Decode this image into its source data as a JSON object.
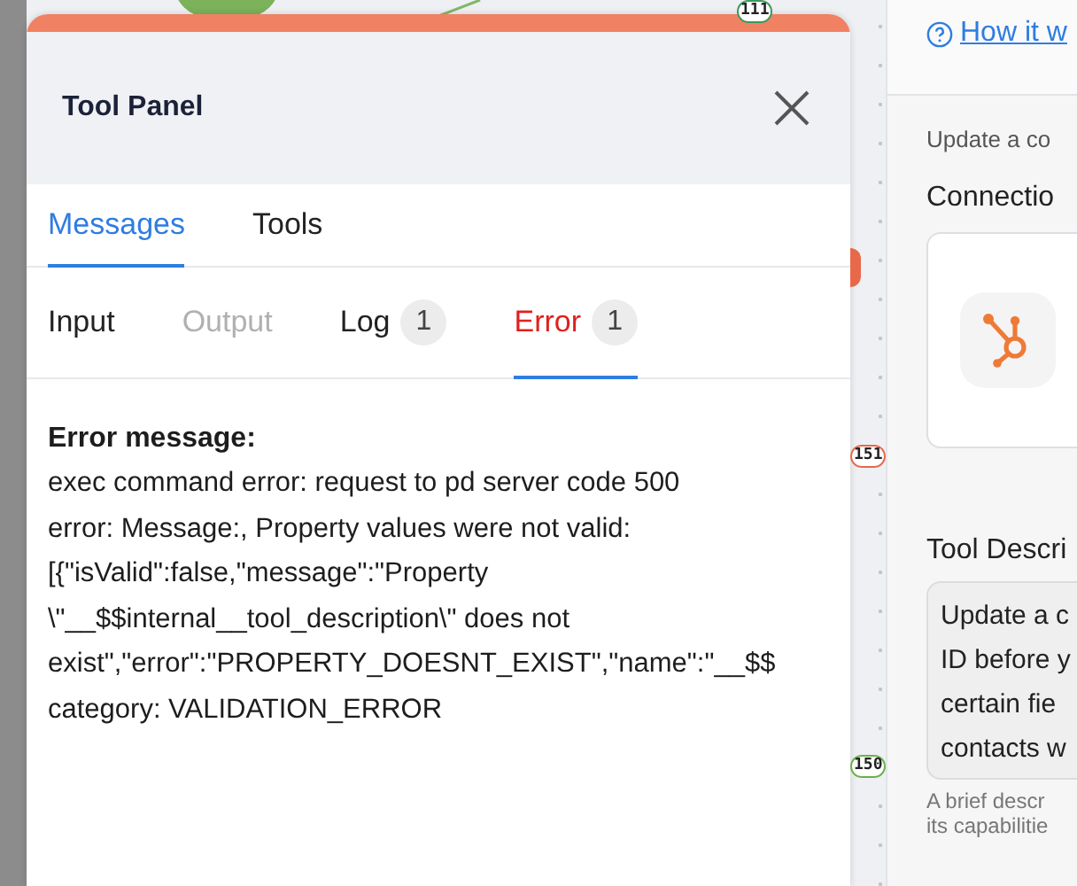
{
  "canvas": {
    "badges": [
      {
        "label": "111",
        "color": "#3a9a5b"
      },
      {
        "label": "151",
        "color": "#e8684a"
      },
      {
        "label": "150",
        "color": "#6ab04c"
      }
    ]
  },
  "tool_panel": {
    "title": "Tool Panel",
    "tabs": [
      {
        "label": "Messages",
        "selected": true
      },
      {
        "label": "Tools",
        "selected": false
      }
    ],
    "subtabs": [
      {
        "label": "Input",
        "kind": "plain",
        "disabled": false,
        "selected": false
      },
      {
        "label": "Output",
        "kind": "plain",
        "disabled": true,
        "selected": false
      },
      {
        "label": "Log",
        "kind": "plain",
        "disabled": false,
        "selected": false,
        "count": "1"
      },
      {
        "label": "Error",
        "kind": "error",
        "disabled": false,
        "selected": true,
        "count": "1"
      }
    ],
    "error_title": "Error message:",
    "error_lines": [
      "exec command error: request to pd server code 500",
      "error: Message:, Property values were not valid:",
      "[{\"isValid\":false,\"message\":\"Property",
      "\\\"__$$internal__tool_description\\\" does not",
      "exist\",\"error\":\"PROPERTY_DOESNT_EXIST\",\"name\":\"__$$",
      "category: VALIDATION_ERROR"
    ]
  },
  "side_panel": {
    "help_link": "How it w",
    "description": "Update a co",
    "connection_label": "Connectio",
    "tool_description_label": "Tool Descri",
    "tool_description_lines": [
      "Update a c",
      "ID before y",
      "certain fie",
      "contacts w"
    ],
    "hint_lines": [
      "A brief descr",
      "its capabilitie"
    ]
  }
}
